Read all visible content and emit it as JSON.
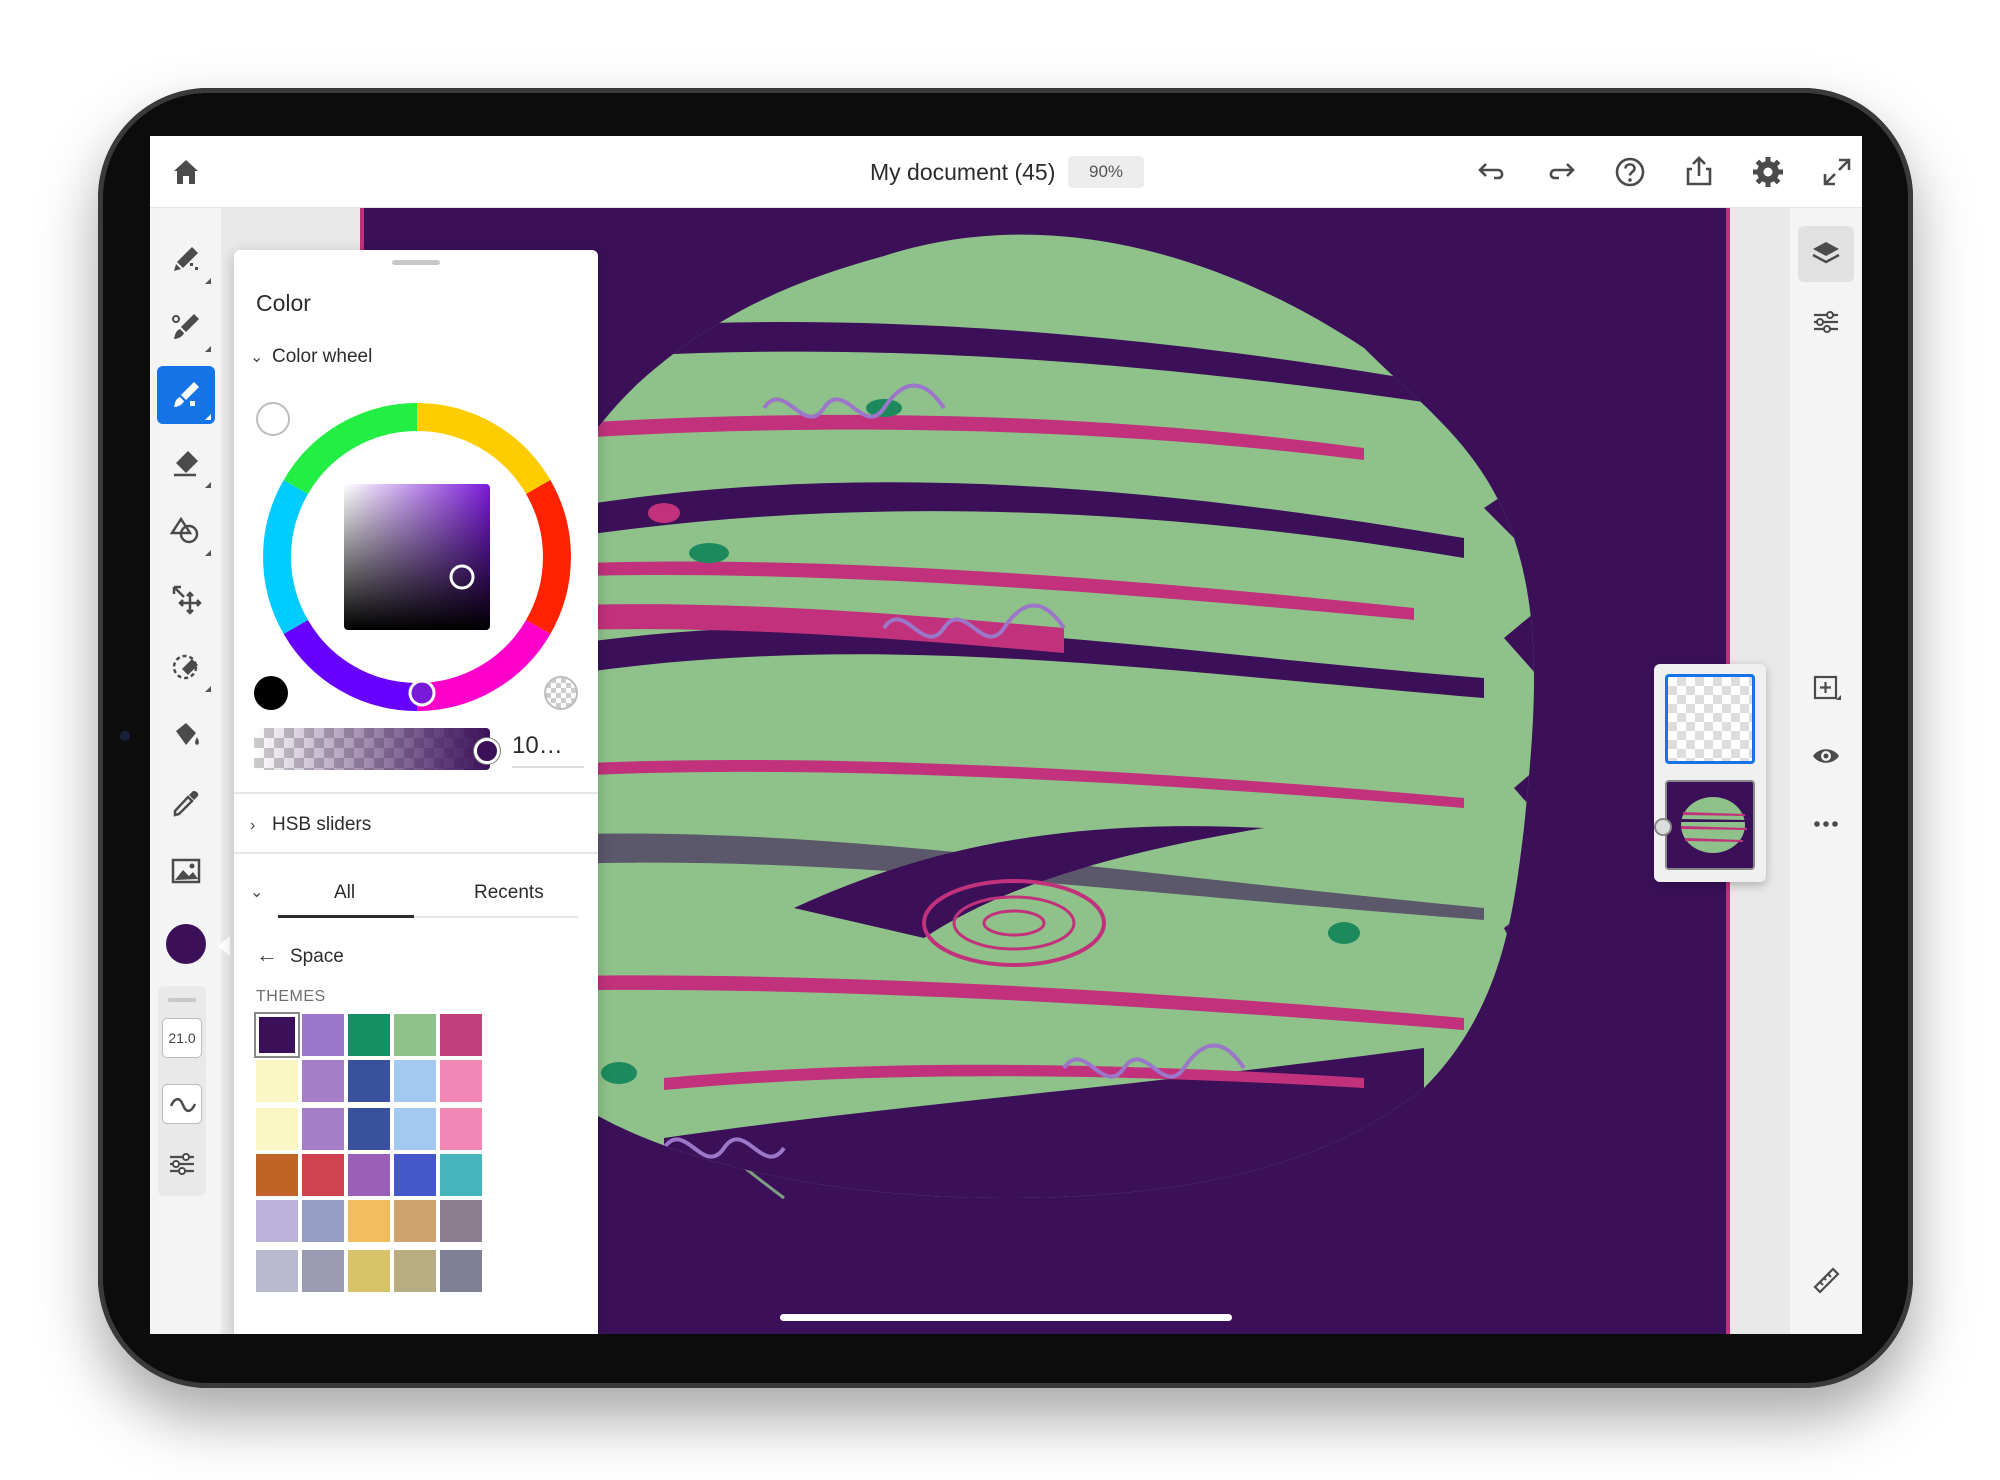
{
  "topbar": {
    "document_title": "My document (45)",
    "zoom": "90%",
    "icons": [
      "home-icon",
      "undo-icon",
      "redo-icon",
      "help-icon",
      "share-icon",
      "settings-icon",
      "fullscreen-icon"
    ]
  },
  "left_toolbar": {
    "tools": [
      "pixel-brush-icon",
      "live-brush-icon",
      "vector-brush-icon",
      "eraser-icon",
      "shape-icon",
      "transform-icon",
      "selection-icon",
      "fill-icon",
      "eyedropper-icon",
      "place-image-icon"
    ],
    "active_tool": "vector-brush-icon",
    "brush_size": "21.0",
    "current_color": "#3b1059"
  },
  "color_panel": {
    "title": "Color",
    "color_wheel_label": "Color wheel",
    "hsb_label": "HSB sliders",
    "opacity_value": "10…",
    "opacity": 1.0,
    "tabs": [
      "All",
      "Recents"
    ],
    "active_tab": "All",
    "library_name": "Space",
    "themes_label": "THEMES",
    "themes": [
      [
        "#3b1059",
        "#9b76c9",
        "#159064",
        "#8fc28a",
        "#c23f7d"
      ],
      [
        "#faf6c3",
        "#a67ec7",
        "#3a519e",
        "#a3c8f2",
        "#f087b5"
      ],
      [
        "#faf6c3",
        "#a67ec7",
        "#3a519e",
        "#a3c8f2",
        "#f087b5"
      ],
      [
        "#c06326",
        "#cf4350",
        "#9a5fb7",
        "#4658c9",
        "#46b5bd"
      ],
      [
        "#bdb3da",
        "#979ec6",
        "#f2bd5c",
        "#cfa26e",
        "#8b7e8f"
      ],
      [
        "#b9bad0",
        "#9a9bb2",
        "#d7c36a",
        "#b8ad80",
        "#7e7f95"
      ]
    ]
  },
  "canvas": {
    "background": "#3b1059",
    "planet_green": "#8fc28a",
    "planet_pink": "#c2327c",
    "accent_teal": "#1c8a5c",
    "accent_lavender": "#9b76c9"
  },
  "right_rail": {
    "icons": [
      "layers-icon",
      "adjustments-icon",
      "add-layer-icon",
      "visibility-icon",
      "more-icon",
      "ruler-icon"
    ]
  },
  "colors": {
    "accent": "#1473e6"
  }
}
